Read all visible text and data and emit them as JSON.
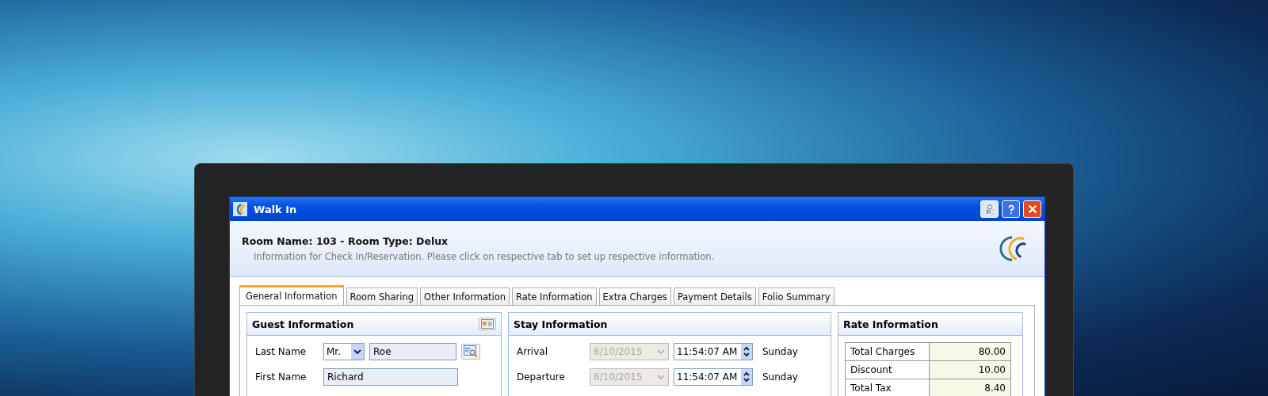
{
  "window": {
    "title": "Walk In"
  },
  "header": {
    "title": "Room Name: 103 - Room Type: Delux",
    "subtitle": "Information for Check In/Reservation. Please click on respective tab to set up respective information."
  },
  "tabs": [
    {
      "label": "General Information",
      "selected": true
    },
    {
      "label": "Room Sharing",
      "selected": false
    },
    {
      "label": "Other Information",
      "selected": false
    },
    {
      "label": "Rate Information",
      "selected": false
    },
    {
      "label": "Extra Charges",
      "selected": false
    },
    {
      "label": "Payment Details",
      "selected": false
    },
    {
      "label": "Folio Summary",
      "selected": false
    }
  ],
  "guest": {
    "title": "Guest Information",
    "last_name_label": "Last Name",
    "salutation": "Mr.",
    "last_name": "Roe",
    "first_name_label": "First Name",
    "first_name": "Richard"
  },
  "stay": {
    "title": "Stay Information",
    "rows": [
      {
        "label": "Arrival",
        "date": "6/10/2015",
        "date_disabled": true,
        "time": "11:54:07 AM",
        "day": "Sunday"
      },
      {
        "label": "Departure",
        "date": "6/10/2015",
        "date_disabled": true,
        "time": "11:54:07 AM",
        "day": "Sunday"
      }
    ]
  },
  "rate": {
    "title": "Rate Information",
    "rows": [
      {
        "label": "Total Charges",
        "value": "80.00"
      },
      {
        "label": "Discount",
        "value": "10.00"
      },
      {
        "label": "Total Tax",
        "value": "8.40"
      }
    ]
  }
}
